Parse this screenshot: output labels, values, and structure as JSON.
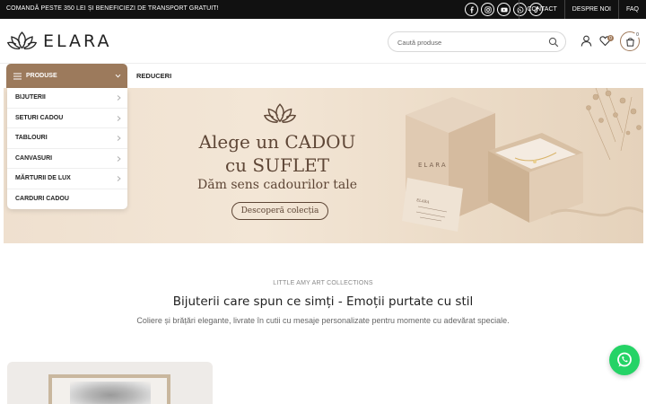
{
  "topbar": {
    "promo": "COMANDĂ PESTE 350 LEI ȘI BENEFICIEZI DE TRANSPORT GRATUIT!",
    "socials": [
      "facebook-icon",
      "instagram-icon",
      "youtube-icon",
      "whatsapp-icon",
      "tiktok-icon"
    ],
    "links": [
      "CONTACT",
      "DESPRE NOI",
      "FAQ"
    ]
  },
  "header": {
    "logo_text": "ELARA",
    "search_placeholder": "Caută produse",
    "wishlist_count": "0",
    "cart_count": "0"
  },
  "nav": {
    "products_label": "PRODUSE",
    "links": [
      "REDUCERI"
    ]
  },
  "menu": {
    "items": [
      "BIJUTERII",
      "SETURI CADOU",
      "TABLOURI",
      "CANVASURI",
      "MĂRTURII DE LUX",
      "CARDURI CADOU"
    ]
  },
  "hero": {
    "line1": "Alege un CADOU",
    "line2": "cu SUFLET",
    "line3": "Dăm sens cadourilor tale",
    "cta": "Descoperă colecția",
    "box_brand": "ELARA",
    "card_brand": "ELARA"
  },
  "section": {
    "kicker": "LITTLE AMY ART COLLECTIONS",
    "heading": "Bijuterii care spun ce simți - Emoții purtate cu stil",
    "subtext": "Coliere și brățări elegante, livrate în cutii cu mesaje personalizate pentru momente cu adevărat speciale."
  },
  "colors": {
    "accent": "#9c7a5c",
    "topbar": "#111111",
    "hero_text": "#5e4636",
    "whatsapp": "#25d366"
  }
}
